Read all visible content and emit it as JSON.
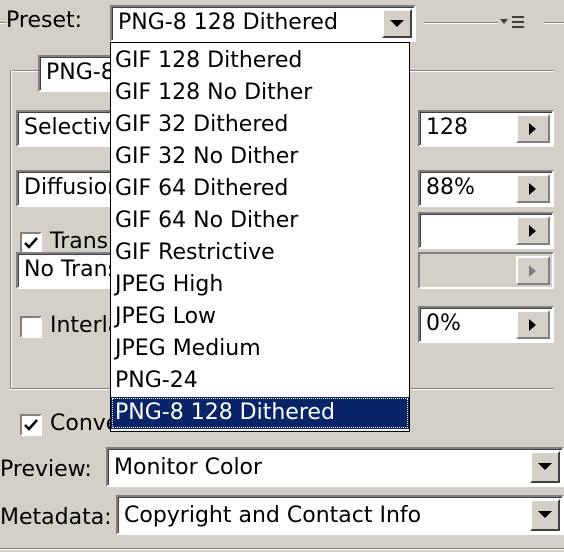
{
  "preset": {
    "label": "Preset:",
    "value": "PNG-8 128 Dithered"
  },
  "format_tab": {
    "value": "PNG-8"
  },
  "reduction": {
    "value": "Selective"
  },
  "dither_algorithm": {
    "value": "Diffusion"
  },
  "transparency": {
    "label": "Transparency",
    "checked": true
  },
  "matte": {
    "value": "No Transparency"
  },
  "interlaced": {
    "label": "Interlaced",
    "checked": false
  },
  "colors": {
    "value": "128"
  },
  "dither": {
    "value": "88%"
  },
  "matte_value": {
    "value": ""
  },
  "amount": {
    "value": ""
  },
  "web_snap": {
    "value": "0%"
  },
  "convert": {
    "label": "Convert to sRGB",
    "checked": true
  },
  "preview": {
    "label": "Preview:",
    "value": "Monitor Color"
  },
  "metadata": {
    "label": "Metadata:",
    "value": "Copyright and Contact Info"
  },
  "preset_options": [
    "GIF 128 Dithered",
    "GIF 128 No Dither",
    "GIF 32 Dithered",
    "GIF 32 No Dither",
    "GIF 64 Dithered",
    "GIF 64 No Dither",
    "GIF Restrictive",
    "JPEG High",
    "JPEG Low",
    "JPEG Medium",
    "PNG-24",
    "PNG-8 128 Dithered"
  ],
  "selected_option": "PNG-8 128 Dithered",
  "icons": {
    "dropdown": "triangle-down-icon",
    "stepper": "triangle-right-icon",
    "panel_menu": "panel-menu-icon"
  }
}
